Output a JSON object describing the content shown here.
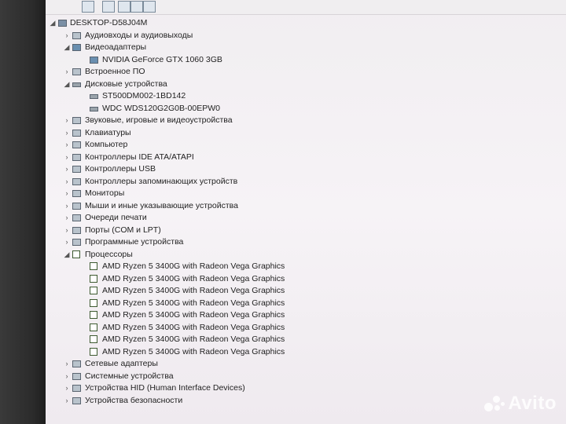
{
  "window": {
    "root": "DESKTOP-D58J04M"
  },
  "tree": [
    {
      "label": "Аудиовходы и аудиовыходы",
      "level": 1,
      "expanded": false,
      "icon": "speaker-icon"
    },
    {
      "label": "Видеоадаптеры",
      "level": 1,
      "expanded": true,
      "icon": "display-adapter-icon"
    },
    {
      "label": "NVIDIA GeForce GTX 1060 3GB",
      "level": 2,
      "icon": "gpu-icon"
    },
    {
      "label": "Встроенное ПО",
      "level": 1,
      "expanded": false,
      "icon": "firmware-icon"
    },
    {
      "label": "Дисковые устройства",
      "level": 1,
      "expanded": true,
      "icon": "disk-drives-icon"
    },
    {
      "label": "ST500DM002-1BD142",
      "level": 2,
      "icon": "disk-icon"
    },
    {
      "label": "WDC WDS120G2G0B-00EPW0",
      "level": 2,
      "icon": "disk-icon"
    },
    {
      "label": "Звуковые, игровые и видеоустройства",
      "level": 1,
      "expanded": false,
      "icon": "sound-icon"
    },
    {
      "label": "Клавиатуры",
      "level": 1,
      "expanded": false,
      "icon": "keyboard-icon"
    },
    {
      "label": "Компьютер",
      "level": 1,
      "expanded": false,
      "icon": "computer-icon"
    },
    {
      "label": "Контроллеры IDE ATA/ATAPI",
      "level": 1,
      "expanded": false,
      "icon": "ide-controller-icon"
    },
    {
      "label": "Контроллеры USB",
      "level": 1,
      "expanded": false,
      "icon": "usb-icon"
    },
    {
      "label": "Контроллеры запоминающих устройств",
      "level": 1,
      "expanded": false,
      "icon": "storage-controller-icon"
    },
    {
      "label": "Мониторы",
      "level": 1,
      "expanded": false,
      "icon": "monitor-icon"
    },
    {
      "label": "Мыши и иные указывающие устройства",
      "level": 1,
      "expanded": false,
      "icon": "mouse-icon"
    },
    {
      "label": "Очереди печати",
      "level": 1,
      "expanded": false,
      "icon": "printer-icon"
    },
    {
      "label": "Порты (COM и LPT)",
      "level": 1,
      "expanded": false,
      "icon": "port-icon"
    },
    {
      "label": "Программные устройства",
      "level": 1,
      "expanded": false,
      "icon": "software-device-icon"
    },
    {
      "label": "Процессоры",
      "level": 1,
      "expanded": true,
      "icon": "processor-icon"
    },
    {
      "label": "AMD Ryzen 5 3400G with Radeon Vega Graphics",
      "level": 2,
      "icon": "cpu-icon"
    },
    {
      "label": "AMD Ryzen 5 3400G with Radeon Vega Graphics",
      "level": 2,
      "icon": "cpu-icon"
    },
    {
      "label": "AMD Ryzen 5 3400G with Radeon Vega Graphics",
      "level": 2,
      "icon": "cpu-icon"
    },
    {
      "label": "AMD Ryzen 5 3400G with Radeon Vega Graphics",
      "level": 2,
      "icon": "cpu-icon"
    },
    {
      "label": "AMD Ryzen 5 3400G with Radeon Vega Graphics",
      "level": 2,
      "icon": "cpu-icon"
    },
    {
      "label": "AMD Ryzen 5 3400G with Radeon Vega Graphics",
      "level": 2,
      "icon": "cpu-icon"
    },
    {
      "label": "AMD Ryzen 5 3400G with Radeon Vega Graphics",
      "level": 2,
      "icon": "cpu-icon"
    },
    {
      "label": "AMD Ryzen 5 3400G with Radeon Vega Graphics",
      "level": 2,
      "icon": "cpu-icon"
    },
    {
      "label": "Сетевые адаптеры",
      "level": 1,
      "expanded": false,
      "icon": "network-icon"
    },
    {
      "label": "Системные устройства",
      "level": 1,
      "expanded": false,
      "icon": "system-device-icon"
    },
    {
      "label": "Устройства HID (Human Interface Devices)",
      "level": 1,
      "expanded": false,
      "icon": "hid-icon"
    },
    {
      "label": "Устройства безопасности",
      "level": 1,
      "expanded": false,
      "icon": "security-icon"
    }
  ],
  "watermark": {
    "text": "Avito"
  }
}
